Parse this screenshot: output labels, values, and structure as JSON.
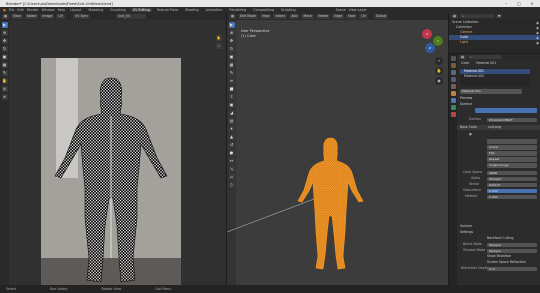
{
  "window": {
    "title": "Blender* [C:\\Users\\aa\\Downloads\\Fixed\\Suit-Untitled.blend]"
  },
  "menubar": {
    "menus": [
      "File",
      "Edit",
      "Render",
      "Window",
      "Help"
    ],
    "workspaces": [
      "Layout",
      "Modeling",
      "Sculpting",
      "UV Editing",
      "Texture Paint",
      "Shading",
      "Animation",
      "Rendering",
      "Compositing",
      "Scripting"
    ],
    "active_workspace": "UV Editing",
    "scene": "Scene",
    "view_layer": "View Layer"
  },
  "uv_editor": {
    "header": [
      "View",
      "Select",
      "Image",
      "UV"
    ],
    "image_name": "Suit_00",
    "mode": "UV Sync"
  },
  "viewport": {
    "header": [
      "Edit Mode",
      "View",
      "Select",
      "Add",
      "Mesh",
      "Vertex",
      "Edge",
      "Face",
      "UV"
    ],
    "orientation": "Global",
    "overlay_title": "User Perspective",
    "overlay_object": "(1) Cube"
  },
  "outliner": {
    "rows": [
      "Scene Collection",
      "Collection",
      "Camera",
      "Cube",
      "Light"
    ]
  },
  "properties": {
    "object": "Cube",
    "material": "Material.001",
    "slots": [
      "Material.001",
      "Material.002"
    ],
    "material_field": "Material.001",
    "sections": {
      "preview": "Preview",
      "surface": "Surface",
      "volume": "Volume",
      "settings": "Settings"
    },
    "surface_label": "Surface",
    "surface_value": "Principled BSDF",
    "base_color_label": "Base Color",
    "base_color_value": "suit.png",
    "linear_label": "Linear",
    "flat_label": "Flat",
    "repeat_label": "Repeat",
    "single_image_label": "Single Image",
    "color_space_label": "Color Space",
    "color_space_value": "sRGB",
    "alpha_label": "Alpha",
    "alpha_value": "Straight",
    "vector_label": "Vector",
    "vector_value": "Default",
    "subsurface_label": "Subsurface",
    "subsurface_value": "0.000",
    "metallic_label": "Metallic",
    "metallic_value": "0.000",
    "backface_label": "Backface Culling",
    "blend_mode_label": "Blend Mode",
    "blend_mode_value": "Opaque",
    "shadow_mode_label": "Shadow Mode",
    "shadow_mode_value": "Opaque",
    "clip_label": "Show Backface",
    "ssr_label": "Screen Space Refraction",
    "refraction_label": "Refraction Depth",
    "refraction_value": "0 m",
    "colors": {
      "accent": "#4772b3",
      "slot_highlight": "#334c7a"
    }
  },
  "statusbar": {
    "items": [
      "Select",
      "Box Select",
      "Rotate View",
      "Call Menu"
    ]
  }
}
